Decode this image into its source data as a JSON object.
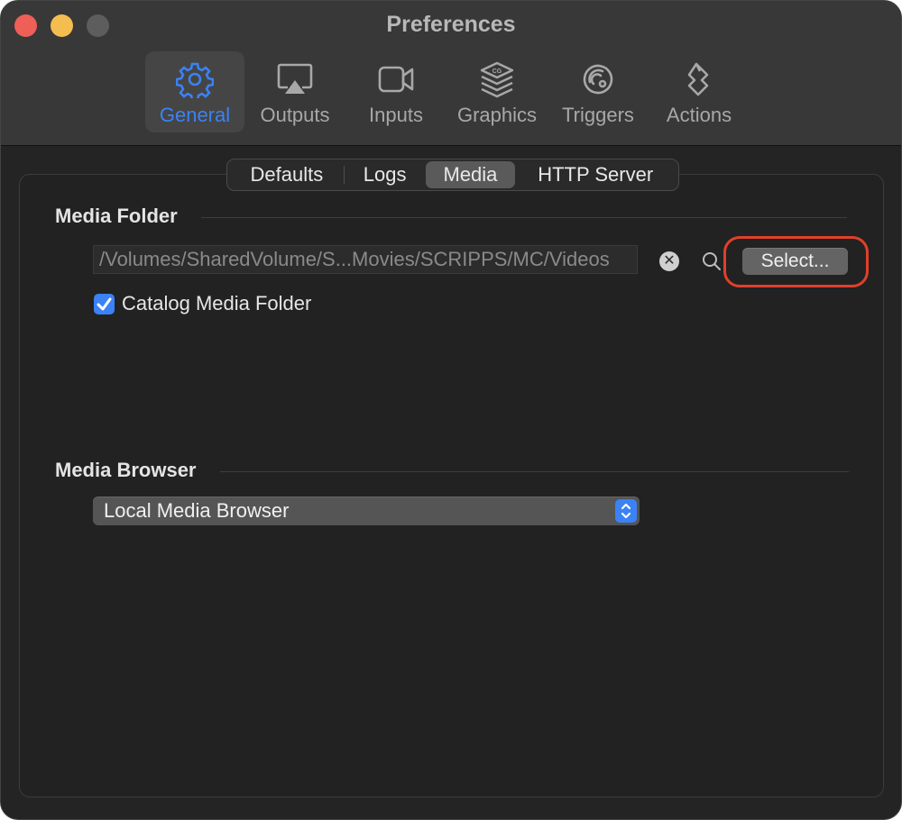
{
  "window": {
    "title": "Preferences"
  },
  "toolbar": {
    "items": [
      {
        "label": "General",
        "icon": "gear-icon",
        "selected": true
      },
      {
        "label": "Outputs",
        "icon": "airplay-display-icon"
      },
      {
        "label": "Inputs",
        "icon": "video-camera-icon"
      },
      {
        "label": "Graphics",
        "icon": "cg-layers-icon"
      },
      {
        "label": "Triggers",
        "icon": "trigger-icon"
      },
      {
        "label": "Actions",
        "icon": "actions-icon"
      }
    ]
  },
  "tabs": {
    "items": [
      {
        "label": "Defaults"
      },
      {
        "label": "Logs"
      },
      {
        "label": "Media",
        "selected": true
      },
      {
        "label": "HTTP Server"
      }
    ]
  },
  "media_folder": {
    "title": "Media Folder",
    "path": "/Volumes/SharedVolume/S...Movies/SCRIPPS/MC/Videos",
    "clear_glyph": "✕",
    "select_label": "Select...",
    "catalog_label": "Catalog Media Folder",
    "catalog_checked": true
  },
  "media_browser": {
    "title": "Media Browser",
    "selected": "Local Media Browser"
  },
  "colors": {
    "accent": "#3b82f6",
    "highlight": "#e0402a",
    "window_bg": "#242424"
  }
}
